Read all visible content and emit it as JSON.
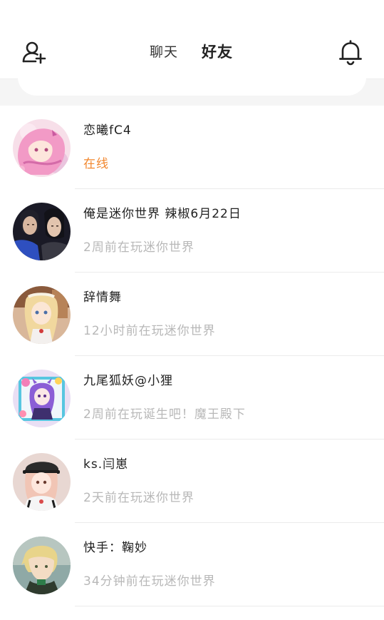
{
  "header": {
    "add_friend_icon": "add-user-icon",
    "notification_icon": "bell-icon",
    "tabs": [
      {
        "label": "聊天",
        "active": false
      },
      {
        "label": "好友",
        "active": true
      }
    ],
    "accent_color": "#f0551e"
  },
  "friends": [
    {
      "name": "恋曦fC4",
      "status": "在线",
      "online": true
    },
    {
      "name": "俺是迷你世界 辣椒6月22日",
      "status": "2周前在玩迷你世界",
      "online": false
    },
    {
      "name": "辞情舞",
      "status": "12小时前在玩迷你世界",
      "online": false
    },
    {
      "name": "九尾狐妖@小狸",
      "status": "2周前在玩诞生吧！魔王殿下",
      "online": false
    },
    {
      "name": "ks.闫崽",
      "status": "2天前在玩迷你世界",
      "online": false
    },
    {
      "name": "快手：鞠妙",
      "status": "34分钟前在玩迷你世界",
      "online": false
    }
  ],
  "colors": {
    "online_status": "#f2872e",
    "offline_status": "#b8b8b8",
    "name_text": "#222222"
  }
}
